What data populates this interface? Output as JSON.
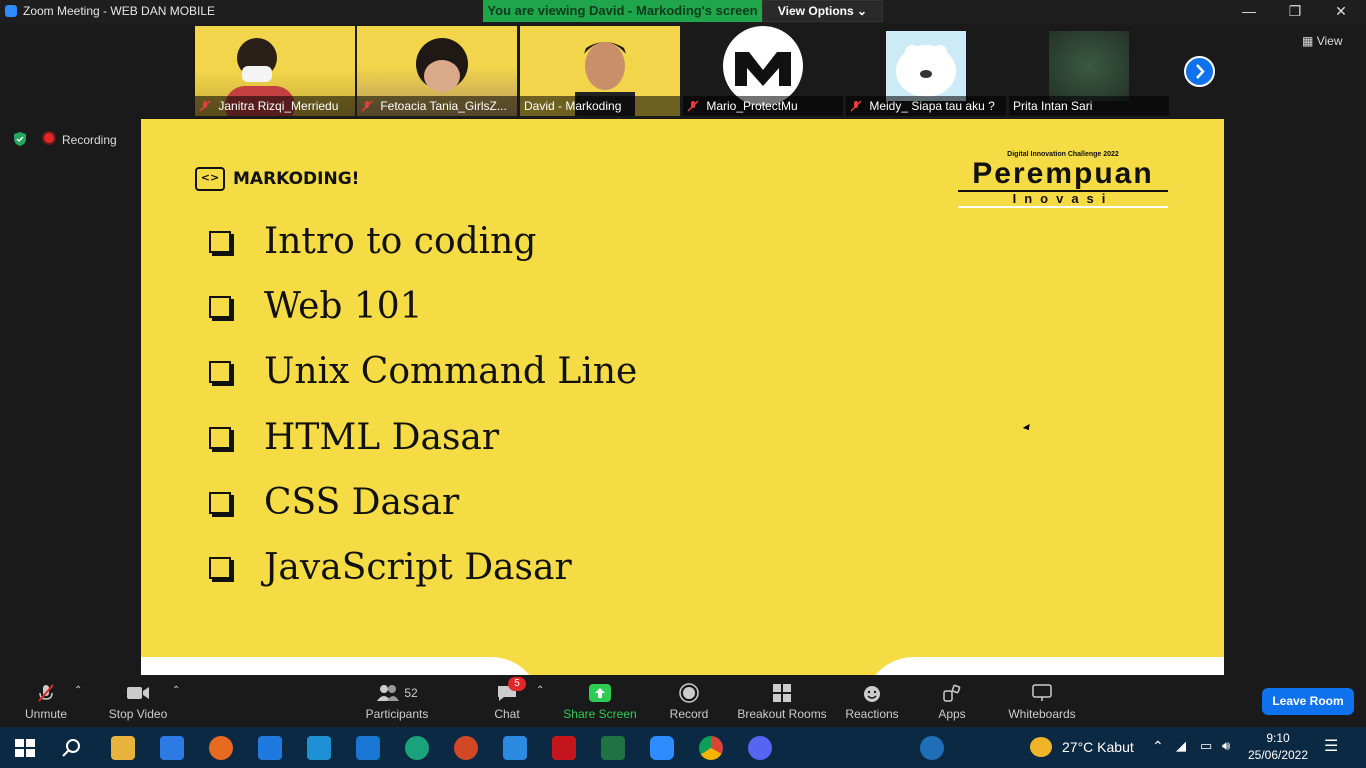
{
  "window": {
    "title": "Zoom Meeting - WEB DAN MOBILE",
    "banner": "You are viewing David - Markoding's screen",
    "view_options": "View Options",
    "view_label": "View",
    "recording": "Recording"
  },
  "participants": [
    {
      "name": "Janitra Rizqi_Merriedu",
      "muted": true
    },
    {
      "name": "Fetoacia Tania_GirlsZ...",
      "muted": true
    },
    {
      "name": "David - Markoding",
      "muted": false
    },
    {
      "name": "Mario_ProtectMu",
      "muted": true
    },
    {
      "name": "Meidy_ Siapa tau aku ?",
      "muted": true
    },
    {
      "name": "Prita Intan Sari",
      "muted": false
    }
  ],
  "slide": {
    "logo_text": "MARKODING!",
    "brand_small": "Digital Innovation Challenge 2022",
    "brand_big": "Perempuan",
    "brand_sub": "Inovasi",
    "agenda": [
      "Intro to coding",
      "Web 101",
      "Unix Command Line",
      "HTML Dasar",
      "CSS Dasar",
      "JavaScript Dasar"
    ]
  },
  "toolbar": {
    "unmute": "Unmute",
    "stop_video": "Stop Video",
    "participants": "Participants",
    "participant_count": "52",
    "chat": "Chat",
    "chat_badge": "5",
    "share_screen": "Share Screen",
    "record": "Record",
    "breakout": "Breakout Rooms",
    "reactions": "Reactions",
    "apps": "Apps",
    "whiteboards": "Whiteboards",
    "leave": "Leave Room"
  },
  "taskbar": {
    "weather": "27°C  Kabut",
    "time": "9:10",
    "date": "25/06/2022"
  },
  "colors": {
    "slide_bg": "#f5dc44",
    "banner": "#1fa64a",
    "accent_blue": "#0e72ed",
    "share_green": "#2ecc55"
  }
}
